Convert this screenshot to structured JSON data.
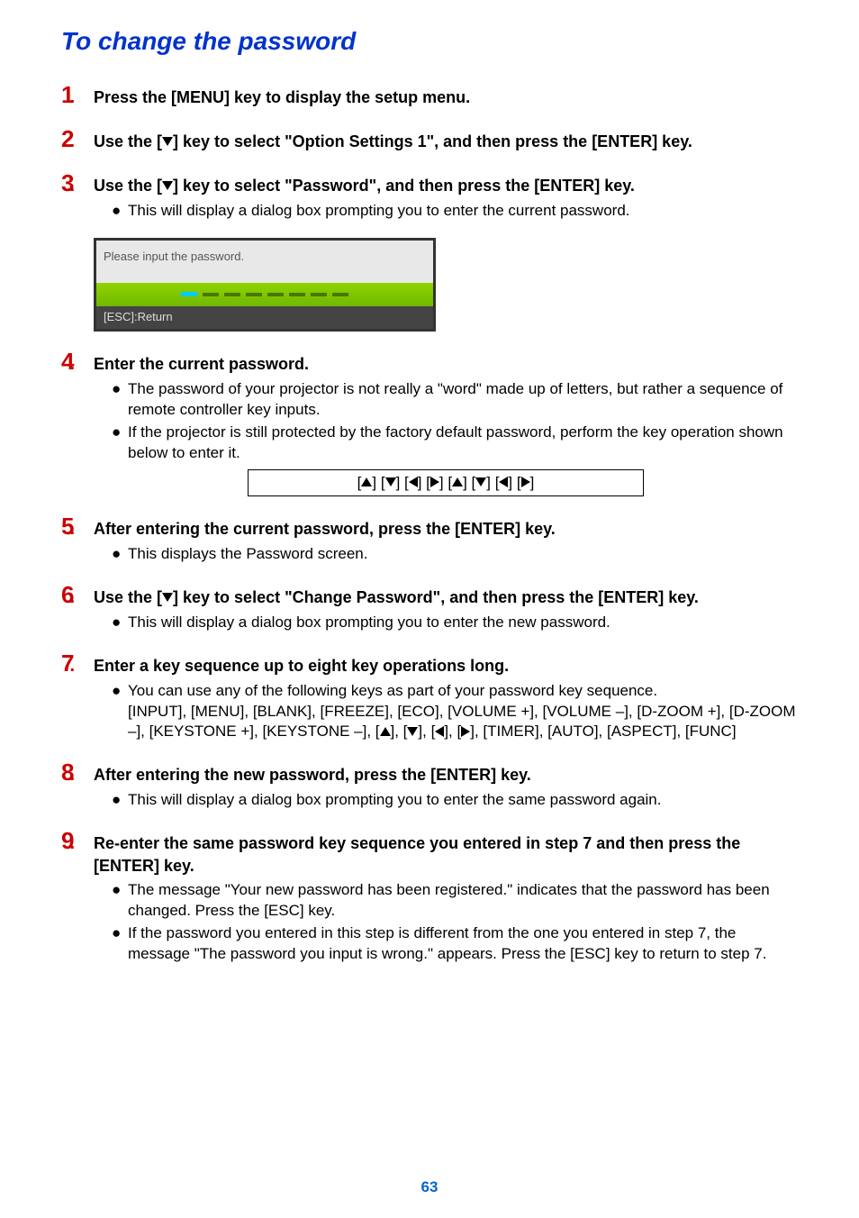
{
  "title": "To change the password",
  "page_number": "63",
  "dialog": {
    "prompt": "Please input the password.",
    "footer": "[ESC]:Return"
  },
  "steps": [
    {
      "num": "1",
      "title_pre": "Press the [MENU] key to display the setup menu.",
      "bullets": []
    },
    {
      "num": "2",
      "title_parts": {
        "pre": "Use the [",
        "icon": "down",
        "post": "] key to select \"Option Settings 1\", and then press the [ENTER] key."
      },
      "bullets": []
    },
    {
      "num": "3",
      "title_parts": {
        "pre": "Use the [",
        "icon": "down",
        "post": "] key to select \"Password\", and then press the [ENTER] key."
      },
      "bullets": [
        "This will display a dialog box prompting you to enter the current password."
      ],
      "has_dialog": true
    },
    {
      "num": "4",
      "title_pre": "Enter the current password.",
      "bullets": [
        "The password of your projector is not really a \"word\" made up of letters, but rather a sequence of remote controller key inputs.",
        "If the projector is still protected by the factory default password, perform the key operation shown below to enter it."
      ],
      "has_seq": true
    },
    {
      "num": "5",
      "title_pre": "After entering the current password, press the [ENTER] key.",
      "bullets": [
        "This displays the Password screen."
      ]
    },
    {
      "num": "6",
      "title_parts": {
        "pre": "Use the [",
        "icon": "down",
        "post": "] key to select \"Change Password\", and then press the [ENTER] key."
      },
      "bullets": [
        "This will display a dialog box prompting you to enter the new password."
      ]
    },
    {
      "num": "7",
      "title_pre": "Enter a key sequence up to eight key operations long.",
      "bullets_complex": {
        "line1": "You can use any of the following keys as part of your password key sequence.",
        "line2_pre": "[INPUT], [MENU], [BLANK], [FREEZE], [ECO], [VOLUME +], [VOLUME –], [D-ZOOM +], [D-ZOOM –], [KEYSTONE +], [KEYSTONE –], [",
        "line2_mid": "], [",
        "line2_post": "], [TIMER], [AUTO], [ASPECT], [FUNC]"
      }
    },
    {
      "num": "8",
      "title_pre": "After entering the new password, press the [ENTER] key.",
      "bullets": [
        "This will display a dialog box prompting you to enter the same password again."
      ]
    },
    {
      "num": "9",
      "title_pre": "Re-enter the same password key sequence you entered in step 7 and then press the [ENTER] key.",
      "bullets": [
        "The message \"Your new password has been registered.\" indicates that the password has been changed. Press the [ESC] key.",
        "If the password you entered in this step is different from the one you entered in step 7, the message \"The password you input is wrong.\" appears. Press the [ESC] key to return to step 7."
      ]
    }
  ]
}
